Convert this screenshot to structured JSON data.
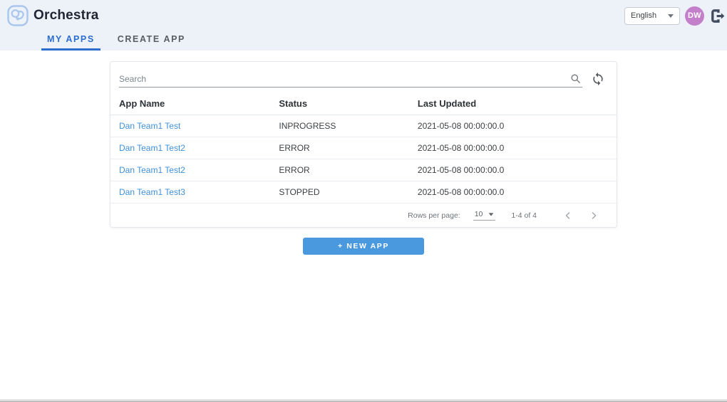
{
  "header": {
    "app_title": "Orchestra",
    "language_value": "English",
    "avatar_initials": "DW"
  },
  "tabs": [
    {
      "label": "MY APPS",
      "active": true
    },
    {
      "label": "CREATE APP",
      "active": false
    }
  ],
  "search": {
    "placeholder": "Search",
    "value": ""
  },
  "table": {
    "columns": [
      "App Name",
      "Status",
      "Last Updated"
    ],
    "rows": [
      {
        "app_name": "Dan Team1 Test",
        "status": "INPROGRESS",
        "last_updated": "2021-05-08 00:00:00.0"
      },
      {
        "app_name": "Dan Team1 Test2",
        "status": "ERROR",
        "last_updated": "2021-05-08 00:00:00.0"
      },
      {
        "app_name": "Dan Team1 Test2",
        "status": "ERROR",
        "last_updated": "2021-05-08 00:00:00.0"
      },
      {
        "app_name": "Dan Team1 Test3",
        "status": "STOPPED",
        "last_updated": "2021-05-08 00:00:00.0"
      }
    ]
  },
  "pagination": {
    "rows_per_page_label": "Rows per page:",
    "rows_per_page_value": "10",
    "range_label": "1-4 of 4"
  },
  "actions": {
    "new_app_label": "+ NEW APP"
  },
  "icons": {
    "logo": "interlocking-circles-rounded-square",
    "search": "magnifier",
    "refresh": "sync-arrows",
    "logout": "exit-arrow-right",
    "dropdown": "caret-down",
    "prev": "chevron-left",
    "next": "chevron-right"
  },
  "colors": {
    "header_background": "#edf1f8",
    "active_tab": "#2b6ed0",
    "link_blue": "#4090d9",
    "button_blue": "#4a99df",
    "avatar_purple": "#c47fcb",
    "logout_dark": "#414c61"
  }
}
